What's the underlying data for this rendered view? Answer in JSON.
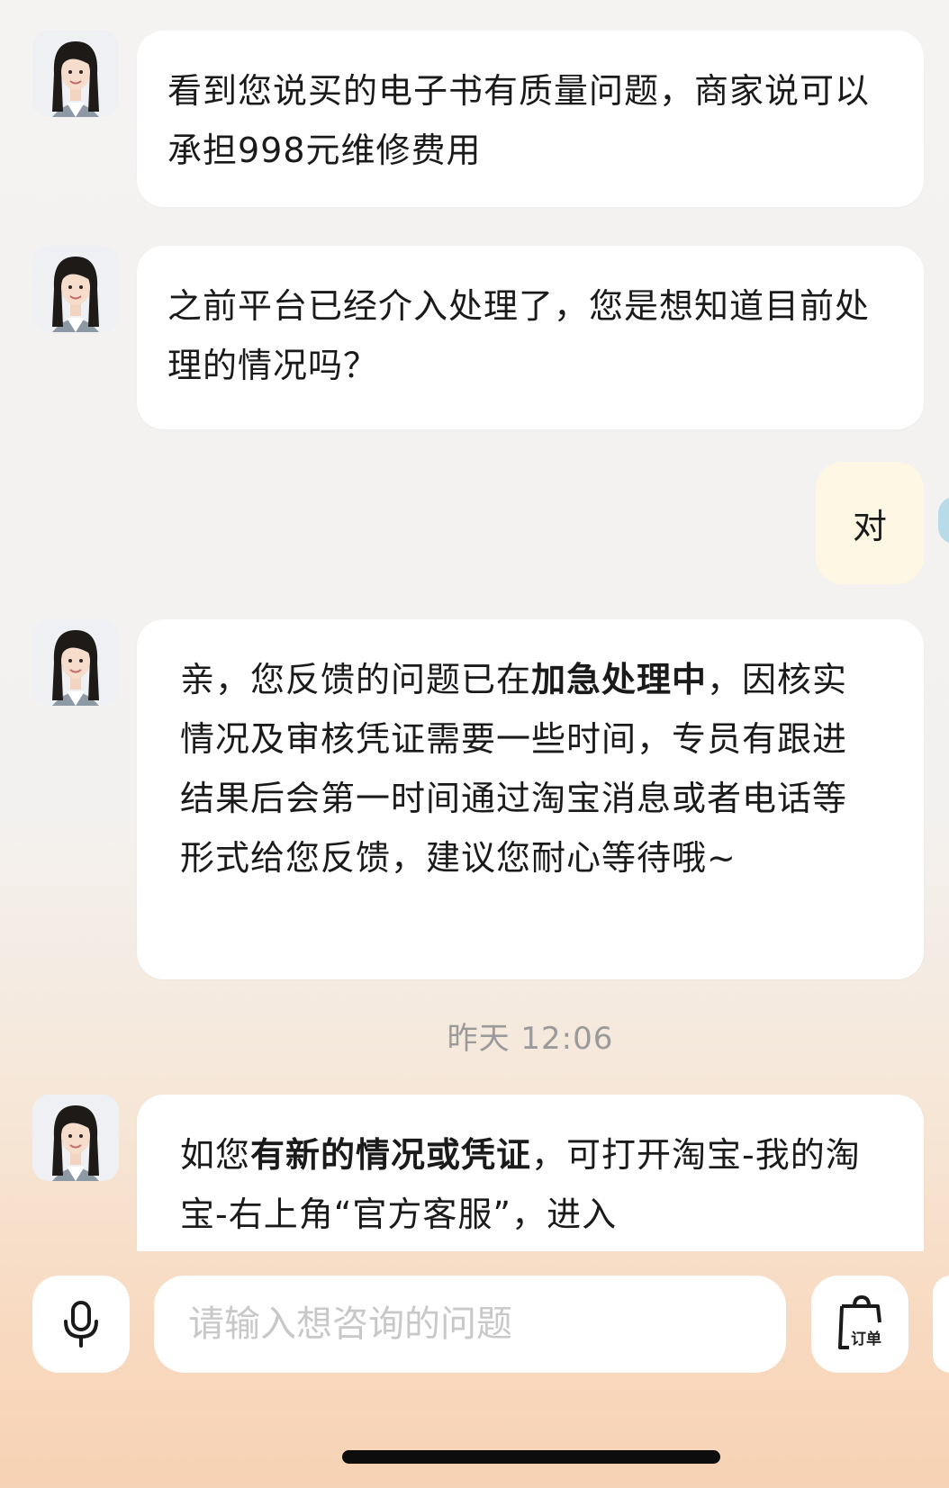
{
  "messages": [
    {
      "from": "agent",
      "text": "看到您说买的电子书有质量问题，商家说可以承担998元维修费用"
    },
    {
      "from": "agent",
      "text": "之前平台已经介入处理了，您是想知道目前处理的情况吗？"
    },
    {
      "from": "user",
      "text": "对"
    },
    {
      "from": "agent",
      "part1": "亲，您反馈的问题已在",
      "bold": "加急处理中",
      "part2": "，因核实情况及审核凭证需要一些时间，专员有跟进结果后会第一时间通过淘宝消息或者电话等形式给您反馈，建议您耐心等待哦~"
    },
    {
      "from": "agent",
      "part1": "如您",
      "bold": "有新的情况或凭证",
      "part2": "，可打开淘宝-我的淘宝-右上角“官方客服”，进入"
    }
  ],
  "timestamp": "昨天 12:06",
  "composer": {
    "input_placeholder": "请输入想咨询的问题",
    "mic_icon": "microphone-icon",
    "orders_icon": "shopping-bag-icon",
    "orders_label": "订单"
  },
  "colors": {
    "agent_bubble": "#ffffff",
    "user_bubble": "#fdf7e4",
    "timestamp_text": "#9a9a9a",
    "placeholder_text": "#c8c8c8"
  }
}
